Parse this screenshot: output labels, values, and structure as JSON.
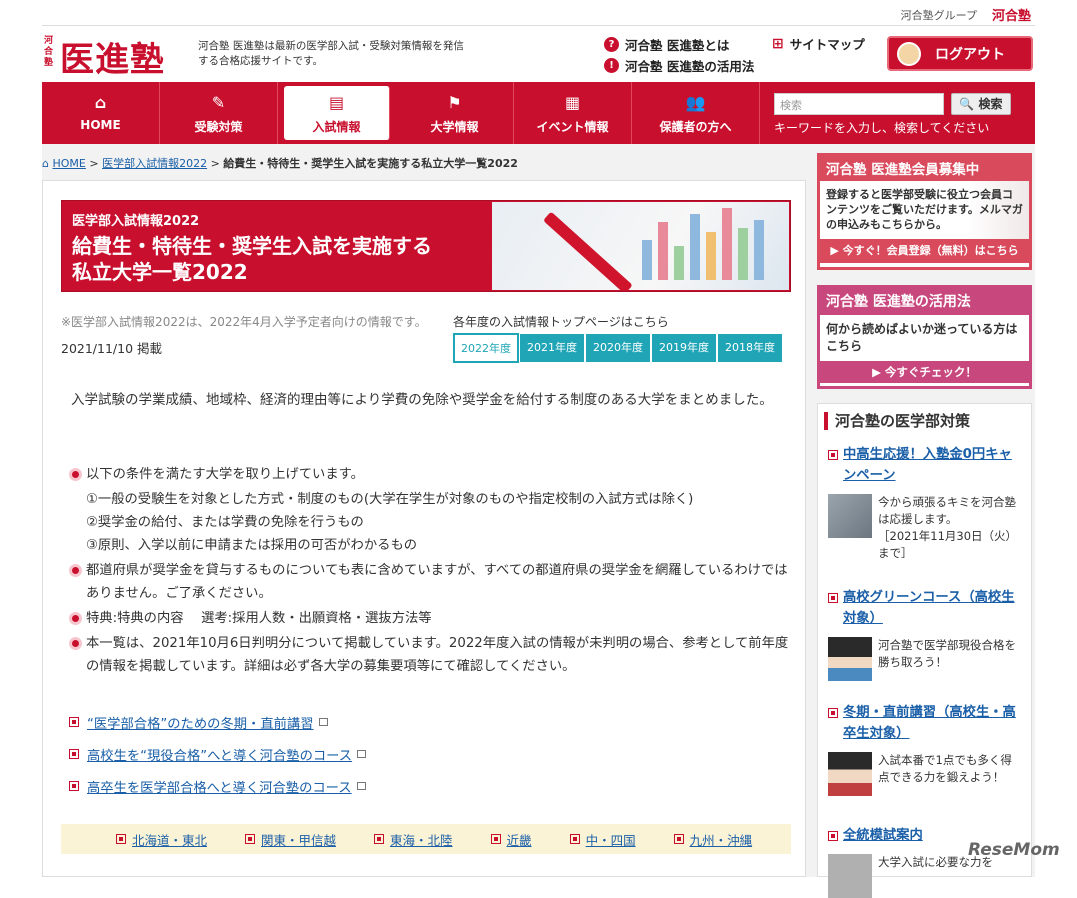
{
  "group_bar": {
    "text": "河合塾グループ",
    "logo": "河合塾"
  },
  "header": {
    "logo_small": "河合塾",
    "logo_main": "医進塾",
    "tagline": "河合塾 医進塾は最新の医学部入試・受験対策情報を発信する合格応援サイトです。",
    "links": [
      "河合塾 医進塾とは",
      "河合塾 医進塾の活用法"
    ],
    "sitemap": "サイトマップ",
    "logout": "ログアウト"
  },
  "nav": {
    "items": [
      {
        "label": "HOME",
        "icon": "home-icon",
        "glyph": "⌂"
      },
      {
        "label": "受験対策",
        "icon": "pencil-icon",
        "glyph": "✎"
      },
      {
        "label": "入試情報",
        "icon": "document-icon",
        "glyph": "▤"
      },
      {
        "label": "大学情報",
        "icon": "flag-icon",
        "glyph": "⚑"
      },
      {
        "label": "イベント情報",
        "icon": "calendar-icon",
        "glyph": "▦"
      },
      {
        "label": "保護者の方へ",
        "icon": "people-icon",
        "glyph": "👥"
      }
    ],
    "search_placeholder": "検索",
    "search_button": "検索",
    "search_hint": "キーワードを入力し、検索してください"
  },
  "breadcrumb": {
    "home": "HOME",
    "level2": "医学部入試情報2022",
    "current": "給費生・特待生・奨学生入試を実施する私立大学一覧2022"
  },
  "hero": {
    "sub": "医学部入試情報2022",
    "title1": "給費生・特待生・奨学生入試を実施する",
    "title2": "私立大学一覧2022"
  },
  "meta": {
    "note": "※医学部入試情報2022は、2022年4月入学予定者向けの情報です。",
    "year_link": "各年度の入試情報トップページはこちら",
    "date": "2021/11/10 掲載",
    "years": [
      "2022年度",
      "2021年度",
      "2020年度",
      "2019年度",
      "2018年度"
    ]
  },
  "intro": "入学試験の学業成績、地域枠、経済的理由等により学費の免除や奨学金を給付する制度のある大学をまとめました。",
  "points": {
    "p1": "以下の条件を満たす大学を取り上げています。",
    "p1a": "①一般の受験生を対象とした方式・制度のもの(大学在学生が対象のものや指定校制の入試方式は除く)",
    "p1b": "②奨学金の給付、または学費の免除を行うもの",
    "p1c": "③原則、入学以前に申請または採用の可否がわかるもの",
    "p2": "都道府県が奨学金を貸与するものについても表に含めていますが、すべての都道府県の奨学金を網羅しているわけではありません。ご了承ください。",
    "p3": "特典:特典の内容　 選考:採用人数・出願資格・選抜方法等",
    "p4": "本一覧は、2021年10月6日判明分について掲載しています。2022年度入試の情報が未判明の場合、参考として前年度の情報を掲載しています。詳細は必ず各大学の募集要項等にて確認してください。"
  },
  "links": [
    "“医学部合格”のための冬期・直前講習",
    "高校生を“現役合格”へと導く河合塾のコース",
    "高卒生を医学部合格へと導く河合塾のコース"
  ],
  "regions": [
    "北海道・東北",
    "関東・甲信越",
    "東海・北陸",
    "近畿",
    "中・四国",
    "九州・沖縄"
  ],
  "banner1": {
    "title": "河合塾 医進塾会員募集中",
    "body": "登録すると医学部受験に役立つ会員コンテンツをご覧いただけます。メルマガの申込みもこちらから。",
    "cta": "今すぐ！会員登録（無料）はこちら"
  },
  "banner2": {
    "title": "河合塾 医進塾の活用法",
    "body": "何から読めばよいか迷っている方はこちら",
    "cta": "今すぐチェック！"
  },
  "sidebar": {
    "heading": "河合塾の医学部対策",
    "items": [
      {
        "title": "中高生応援！入塾金0円キャンペーン",
        "desc": "今から頑張るキミを河合塾は応援します。",
        "note": "［2021年11月30日（火）まで］"
      },
      {
        "title": "高校グリーンコース（高校生対象）",
        "desc": "河合塾で医学部現役合格を勝ち取ろう！",
        "note": ""
      },
      {
        "title": "冬期・直前講習（高校生・高卒生対象）",
        "desc": "入試本番で1点でも多く得点できる力を鍛えよう！",
        "note": ""
      },
      {
        "title": "全統模試案内",
        "desc": "大学入試に必要な力を",
        "note": ""
      }
    ]
  },
  "watermark": "ReseMom",
  "colors": {
    "brand": "#c8102e",
    "teal": "#1fa5b6",
    "link": "#1a5fa8"
  }
}
